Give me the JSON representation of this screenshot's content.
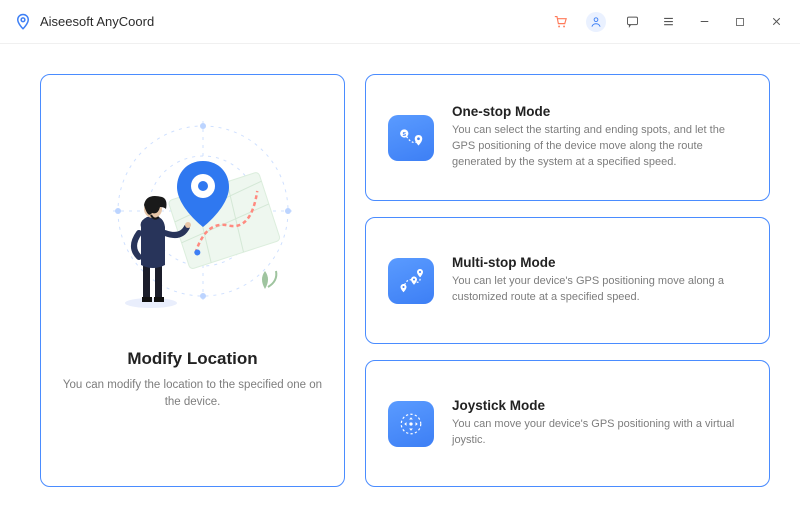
{
  "app": {
    "title": "Aiseesoft AnyCoord"
  },
  "main": {
    "modify_location": {
      "title": "Modify Location",
      "desc": "You can modify the location to the specified one on the device."
    },
    "modes": [
      {
        "title": "One-stop Mode",
        "desc": "You can select the starting and ending spots, and let the GPS positioning of the device move along the route generated by the system at a specified speed."
      },
      {
        "title": "Multi-stop Mode",
        "desc": "You can let your device's GPS positioning move along a customized route at a specified speed."
      },
      {
        "title": "Joystick Mode",
        "desc": "You can move your device's GPS positioning with a virtual joystic."
      }
    ]
  }
}
